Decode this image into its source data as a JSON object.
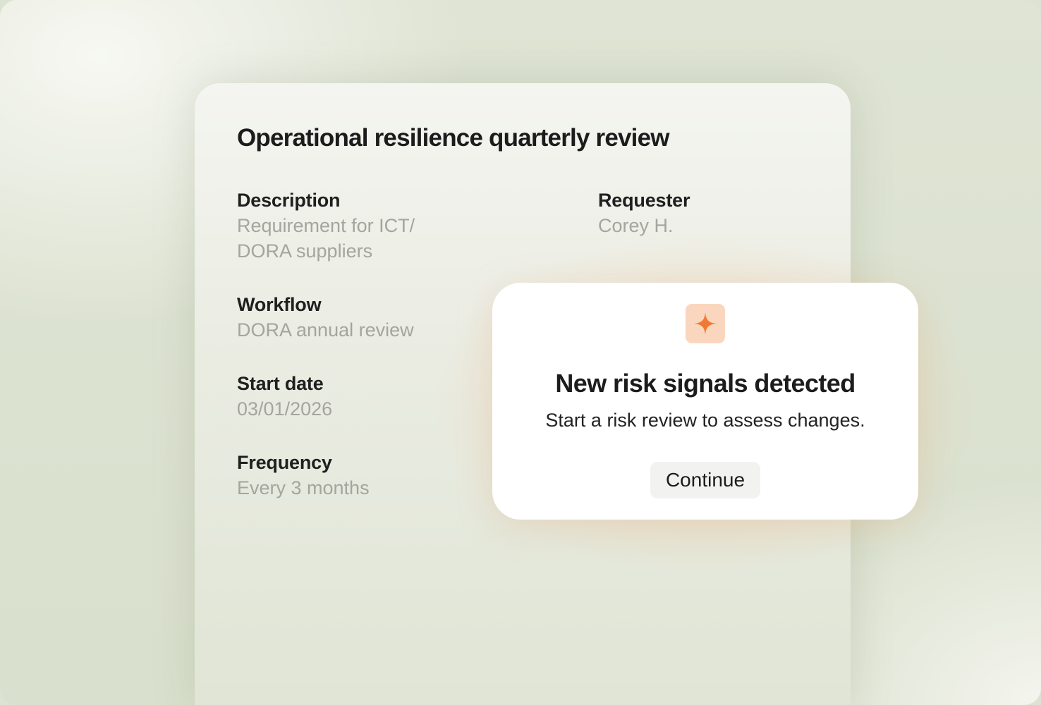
{
  "review": {
    "title": "Operational resilience quarterly review",
    "fields": {
      "description": {
        "label": "Description",
        "value": "Requirement for ICT/\nDORA suppliers"
      },
      "requester": {
        "label": "Requester",
        "value": "Corey H."
      },
      "workflow": {
        "label": "Workflow",
        "value": "DORA annual review"
      },
      "start_date": {
        "label": "Start date",
        "value": "03/01/2026"
      },
      "frequency": {
        "label": "Frequency",
        "value": "Every 3 months"
      }
    }
  },
  "modal": {
    "icon": "sparkle-icon",
    "title": "New risk signals detected",
    "subtitle": "Start a risk review to assess changes.",
    "button_label": "Continue"
  },
  "colors": {
    "accent": "#f07a35",
    "icon_tile": "#fbd6be",
    "label_text": "#1f1f1f",
    "value_text": "#a3a59e",
    "background": "#dde3d3"
  }
}
